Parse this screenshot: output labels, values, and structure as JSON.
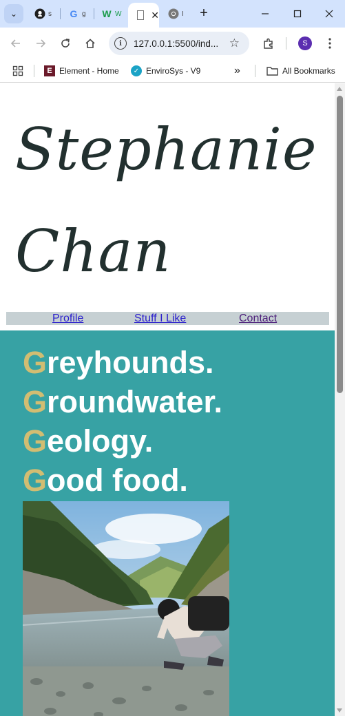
{
  "browser": {
    "tabs": [
      {
        "title": "s",
        "icon": "github-icon"
      },
      {
        "title": "g",
        "icon": "google-icon"
      },
      {
        "title": "W",
        "icon": "webflow-icon"
      },
      {
        "title": "",
        "icon": "page-icon",
        "active": true
      },
      {
        "title": "I",
        "icon": "chrome-icon"
      }
    ],
    "url": "127.0.0.1:5500/ind...",
    "profile_initial": "S",
    "bookmarks": [
      {
        "label": "Element - Home",
        "icon": "element-icon"
      },
      {
        "label": "EnviroSys - V9",
        "icon": "check-badge-icon"
      }
    ],
    "all_bookmarks_label": "All Bookmarks",
    "colors": {
      "tabstrip": "#d3e3fd",
      "omnibox": "#e9eef6",
      "profile": "#5b2eb0"
    }
  },
  "site": {
    "name_line1": "Stephanie",
    "name_line2": "Chan",
    "nav": [
      "Profile",
      "Stuff I Like",
      "Contact"
    ],
    "hero_lines": [
      {
        "first": "G",
        "rest": "reyhounds."
      },
      {
        "first": "G",
        "rest": "roundwater."
      },
      {
        "first": "G",
        "rest": "eology."
      },
      {
        "first": "G",
        "rest": "ood food."
      }
    ],
    "colors": {
      "nav_bg": "#c6d0d3",
      "hero_bg": "#37a2a4",
      "accent": "#d2bd72",
      "name": "#22302f"
    }
  }
}
